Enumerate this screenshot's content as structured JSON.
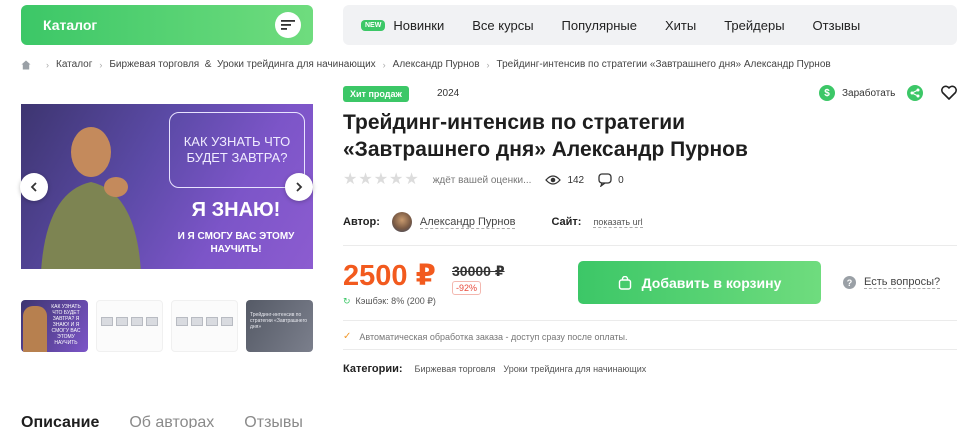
{
  "header": {
    "catalog_label": "Каталог",
    "new_badge": "NEW",
    "nav": [
      "Новинки",
      "Все курсы",
      "Популярные",
      "Хиты",
      "Трейдеры",
      "Отзывы"
    ]
  },
  "breadcrumb": [
    "Каталог",
    "Биржевая торговля  &  Уроки трейдинга для начинающих",
    "Александр Пурнов",
    "Трейдинг-интенсив по стратегии «Завтрашнего дня» Александр Пурнов"
  ],
  "gallery": {
    "question": "КАК УЗНАТЬ ЧТО БУДЕТ ЗАВТРА?",
    "answer": "Я ЗНАЮ!",
    "promise": "И Я СМОГУ ВАС ЭТОМУ НАУЧИТЬ!",
    "thumb1_text": "КАК УЗНАТЬ ЧТО БУДЕТ ЗАВТРА? Я ЗНАЮ! И Я СМОГУ ВАС ЭТОМУ НАУЧИТЬ",
    "thumb4_text": "Трейдинг-интенсив по стратегии «Завтрашнего дня»"
  },
  "product": {
    "badge": "Хит продаж",
    "year": "2024",
    "earn_label": "Заработать",
    "title": "Трейдинг-интенсив по стратегии «Завтрашнего дня» Александр Пурнов",
    "rating": 0,
    "rating_text": "ждёт вашей оценки...",
    "views": "142",
    "comments": "0",
    "author_label": "Автор:",
    "author_name": "Александр Пурнов",
    "site_label": "Сайт:",
    "show_url": "показать url",
    "price": "2500 ₽",
    "old_price": "30000 ₽",
    "discount": "-92%",
    "cashback": "Кэшбэк: 8% (200 ₽)",
    "cart_button": "Добавить в корзину",
    "questions": "Есть вопросы?",
    "auto_processing": "Автоматическая обработка заказа - доступ сразу после оплаты.",
    "categories_label": "Категории:",
    "categories": [
      "Биржевая торговля",
      "Уроки трейдинга для начинающих"
    ]
  },
  "tabs": [
    "Описание",
    "Об авторах",
    "Отзывы"
  ],
  "colors": {
    "accent": "#3cc767",
    "price": "#f25a1e",
    "discount": "#e84a3b"
  }
}
